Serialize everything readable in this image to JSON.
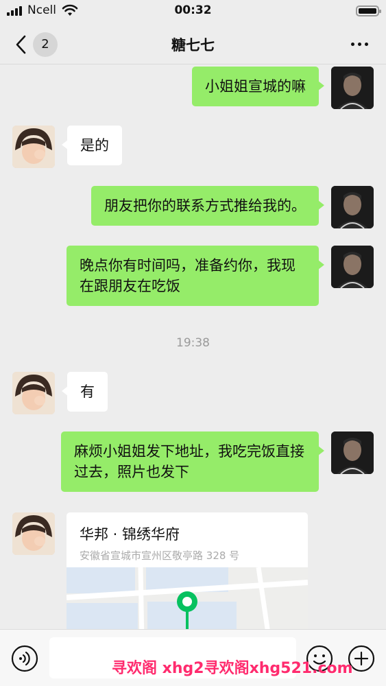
{
  "status_bar": {
    "carrier": "Ncell",
    "time": "00:32"
  },
  "header": {
    "back_count": "2",
    "title": "糖七七"
  },
  "messages": [
    {
      "side": "out",
      "text": "小姐姐宣城的嘛"
    },
    {
      "side": "in",
      "text": "是的"
    },
    {
      "side": "out",
      "text": "朋友把你的联系方式推给我的。"
    },
    {
      "side": "out",
      "text": "晚点你有时间吗，准备约你，我现在跟朋友在吃饭"
    },
    {
      "side": "in",
      "text": "有"
    },
    {
      "side": "out",
      "text": "麻烦小姐姐发下地址，我吃完饭直接过去，照片也发下"
    }
  ],
  "timestamp": "19:38",
  "location_card": {
    "name": "华邦 · 锦绣华府",
    "address": "安徽省宣城市宣州区敬亭路 328 号"
  },
  "input": {
    "placeholder": ""
  },
  "watermark": "寻欢阁 xhg2寻欢阁xhg521.com",
  "colors": {
    "background": "#ededed",
    "outgoing_bubble": "#95ec69",
    "incoming_bubble": "#ffffff",
    "map_pin": "#07c160",
    "watermark": "#ff2b6e"
  }
}
